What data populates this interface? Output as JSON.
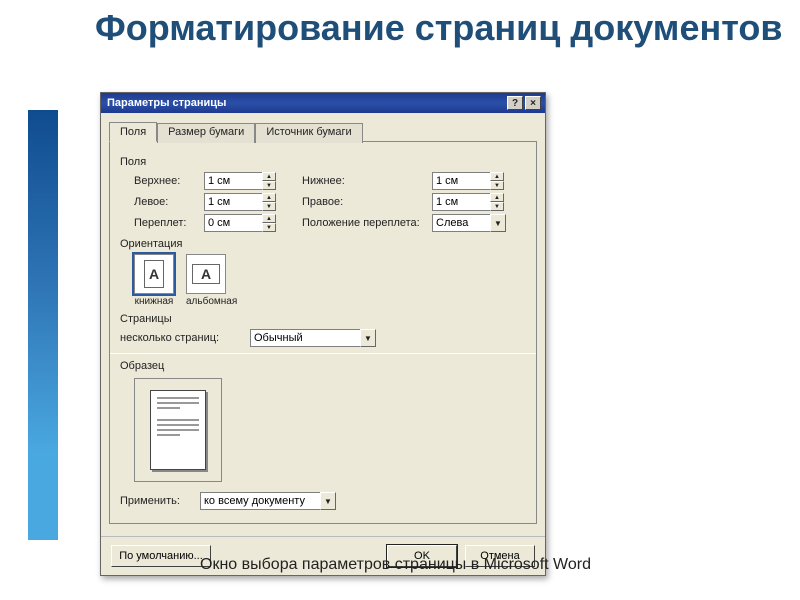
{
  "page": {
    "title": "Форматирование страниц документов",
    "caption": "Окно выбора параметров страницы в Microsoft Word"
  },
  "dialog": {
    "title": "Параметры страницы",
    "tabs": {
      "fields": "Поля",
      "paper_size": "Размер бумаги",
      "paper_source": "Источник бумаги"
    },
    "groups": {
      "margins": "Поля",
      "orientation": "Ориентация",
      "pages": "Страницы",
      "preview": "Образец"
    },
    "margins": {
      "top_label": "Верхнее:",
      "top_value": "1 см",
      "bottom_label": "Нижнее:",
      "bottom_value": "1 см",
      "left_label": "Левое:",
      "left_value": "1 см",
      "right_label": "Правое:",
      "right_value": "1 см",
      "gutter_label": "Переплет:",
      "gutter_value": "0 см",
      "gutter_pos_label": "Положение переплета:",
      "gutter_pos_value": "Слева"
    },
    "orientation": {
      "portrait": "книжная",
      "landscape": "альбомная",
      "selected": "portrait"
    },
    "pages": {
      "multi_label": "несколько страниц:",
      "multi_value": "Обычный"
    },
    "apply": {
      "label": "Применить:",
      "value": "ко всему документу"
    },
    "buttons": {
      "default": "По умолчанию...",
      "ok": "OK",
      "cancel": "Отмена"
    }
  }
}
